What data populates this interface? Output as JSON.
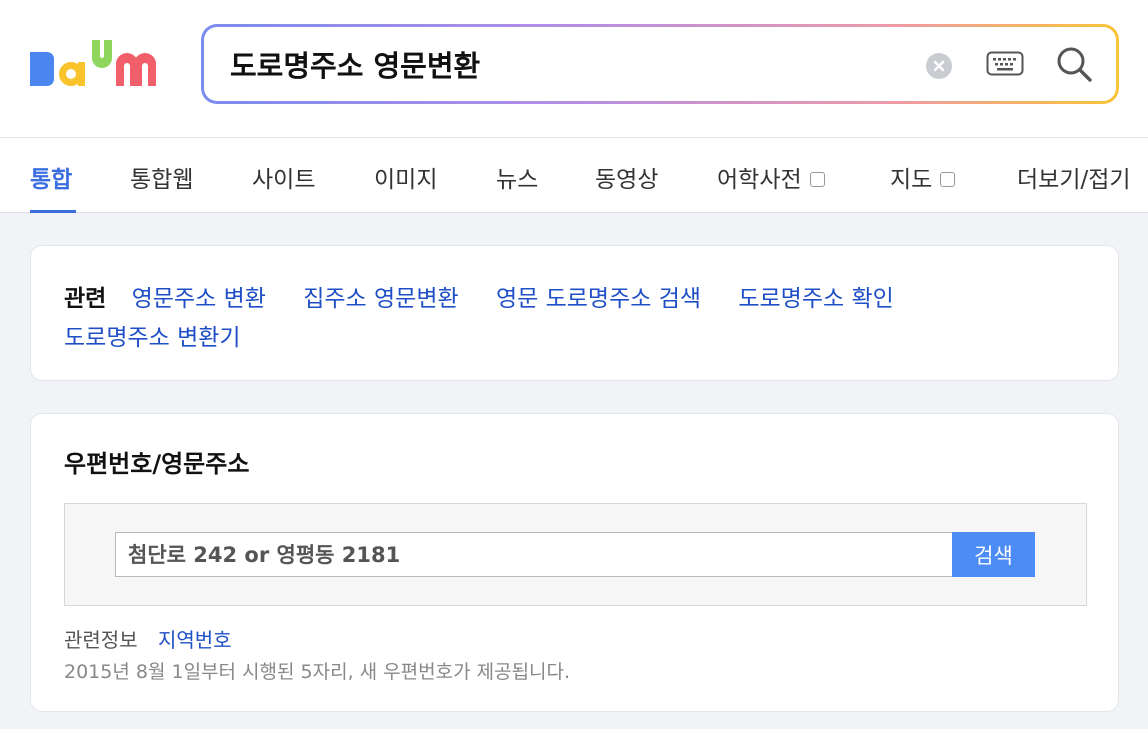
{
  "search": {
    "query": "도로명주소 영문변환",
    "logo_text": "Daum"
  },
  "tabs": [
    {
      "label": "통합",
      "active": true
    },
    {
      "label": "통합웹"
    },
    {
      "label": "사이트"
    },
    {
      "label": "이미지"
    },
    {
      "label": "뉴스"
    },
    {
      "label": "동영상"
    },
    {
      "label": "어학사전",
      "external": true
    },
    {
      "label": "지도",
      "external": true
    },
    {
      "label": "더보기/접기"
    }
  ],
  "related": {
    "title": "관련",
    "links": [
      "영문주소 변환",
      "집주소 영문변환",
      "영문 도로명주소 검색",
      "도로명주소 확인",
      "도로명주소 변환기"
    ]
  },
  "zip": {
    "title": "우편번호/영문주소",
    "placeholder": "첨단로 242 or 영평동 2181",
    "button": "검색",
    "info_label": "관련정보",
    "info_link": "지역번호",
    "notice": "2015년 8월 1일부터 시행된 5자리, 새 우편번호가 제공됩니다."
  },
  "colors": {
    "accent": "#3b6fe0",
    "link": "#1f4fc6",
    "search_button": "#4d8cf5"
  },
  "icons": [
    "clear-icon",
    "keyboard-icon",
    "search-icon",
    "external-window-icon"
  ]
}
